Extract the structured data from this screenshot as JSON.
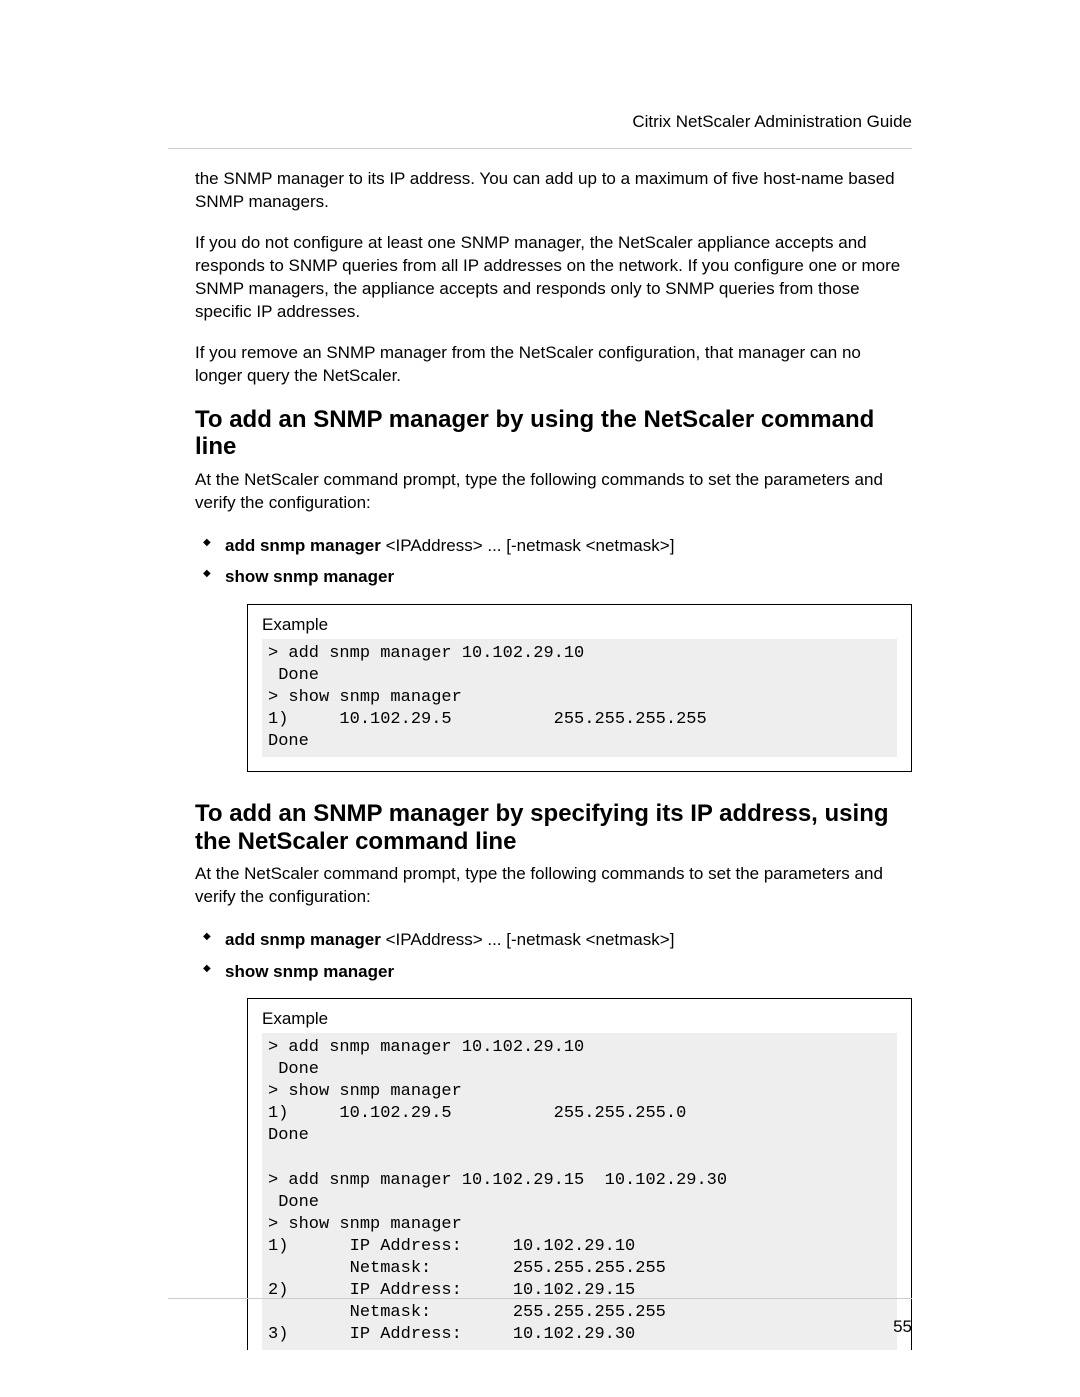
{
  "header": {
    "title": "Citrix NetScaler Administration Guide"
  },
  "paragraphs": {
    "p1": "the SNMP manager to its IP address. You can add up to a maximum of five host-name based SNMP managers.",
    "p2": "If you do not configure at least one SNMP manager, the NetScaler appliance accepts and responds to SNMP queries from all IP addresses on the network. If you configure one or more SNMP managers, the appliance accepts and responds only to SNMP queries from those specific IP addresses.",
    "p3": "If you remove an SNMP manager from the NetScaler configuration, that manager can no longer query the NetScaler."
  },
  "section1": {
    "title": "To add an SNMP manager by using the NetScaler command line",
    "intro": "At the NetScaler command prompt, type the following commands to set the parameters and verify the configuration:",
    "bullets": [
      {
        "bold": "add snmp manager",
        "rest": " <IPAddress> ... [-netmask <netmask>]"
      },
      {
        "bold": "show snmp manager",
        "rest": ""
      }
    ],
    "example_label": "Example",
    "example_code": "> add snmp manager 10.102.29.10\n Done\n> show snmp manager\n1)     10.102.29.5          255.255.255.255\nDone"
  },
  "section2": {
    "title": "To add an SNMP manager by specifying its IP address, using the NetScaler command line",
    "intro": "At the NetScaler command prompt, type the following commands to set the parameters and verify the configuration:",
    "bullets": [
      {
        "bold": "add snmp manager",
        "rest": " <IPAddress> ... [-netmask <netmask>]"
      },
      {
        "bold": "show snmp manager",
        "rest": ""
      }
    ],
    "example_label": "Example",
    "example_code": "> add snmp manager 10.102.29.10\n Done\n> show snmp manager\n1)     10.102.29.5          255.255.255.0\nDone\n\n> add snmp manager 10.102.29.15  10.102.29.30\n Done\n> show snmp manager\n1)      IP Address:     10.102.29.10\n        Netmask:        255.255.255.255\n2)      IP Address:     10.102.29.15\n        Netmask:        255.255.255.255\n3)      IP Address:     10.102.29.30"
  },
  "page_number": "55"
}
